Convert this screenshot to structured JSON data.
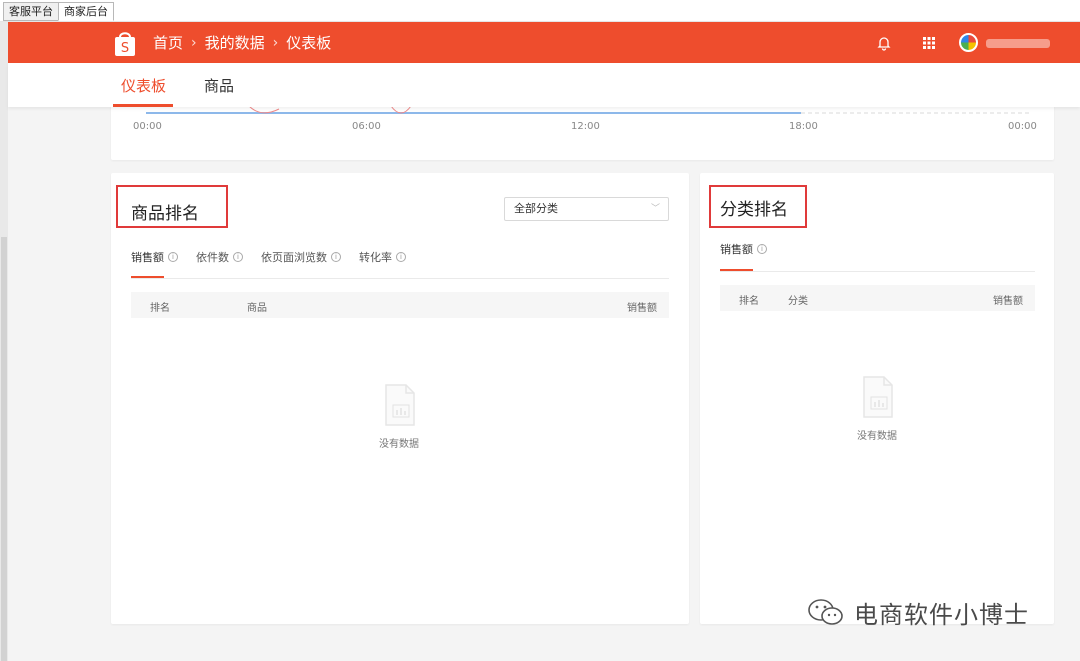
{
  "browser_tabs": [
    {
      "label": "客服平台"
    },
    {
      "label": "商家后台"
    }
  ],
  "header": {
    "breadcrumb": [
      "首页",
      "我的数据",
      "仪表板"
    ],
    "brand_color": "#ee4d2d",
    "icons": [
      "shopee-bag-icon",
      "bell-icon",
      "apps-grid-icon",
      "avatar"
    ]
  },
  "subnav": {
    "tabs": [
      {
        "label": "仪表板",
        "active": true
      },
      {
        "label": "商品",
        "active": false
      }
    ]
  },
  "chart": {
    "x_ticks": [
      "00:00",
      "06:00",
      "12:00",
      "18:00",
      "00:00"
    ]
  },
  "product_ranking": {
    "title": "商品排名",
    "category_select": "全部分类",
    "metric_tabs": [
      {
        "label": "销售额",
        "active": true
      },
      {
        "label": "依件数",
        "active": false
      },
      {
        "label": "依页面浏览数",
        "active": false
      },
      {
        "label": "转化率",
        "active": false
      }
    ],
    "columns": [
      "排名",
      "商品",
      "销售额"
    ],
    "empty_text": "没有数据"
  },
  "category_ranking": {
    "title": "分类排名",
    "metric_tabs": [
      {
        "label": "销售额",
        "active": true
      }
    ],
    "columns": [
      "排名",
      "分类",
      "销售额"
    ],
    "empty_text": "没有数据"
  },
  "watermark": {
    "text": "电商软件小博士"
  }
}
